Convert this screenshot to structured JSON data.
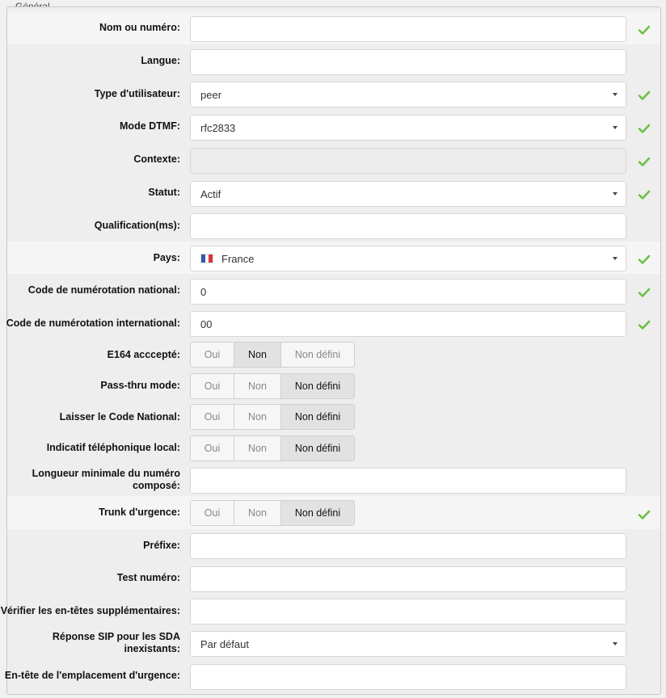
{
  "section_title": "Général",
  "rows": [
    {
      "label": "Nom ou numéro:",
      "type": "input",
      "value": "",
      "check": true
    },
    {
      "label": "Langue:",
      "type": "input",
      "value": "",
      "check": false
    },
    {
      "label": "Type d'utilisateur:",
      "type": "select",
      "value": "peer",
      "check": true
    },
    {
      "label": "Mode DTMF:",
      "type": "select",
      "value": "rfc2833",
      "check": true
    },
    {
      "label": "Contexte:",
      "type": "disabled",
      "value": "",
      "check": true
    },
    {
      "label": "Statut:",
      "type": "select",
      "value": "Actif",
      "check": true
    },
    {
      "label": "Qualification(ms):",
      "type": "input",
      "value": "",
      "check": false
    },
    {
      "label": "Pays:",
      "type": "select-flag",
      "value": "France",
      "check": true
    },
    {
      "label": "Code de numérotation national:",
      "type": "input",
      "value": "0",
      "check": true
    },
    {
      "label": "Code de numérotation international:",
      "type": "input",
      "value": "00",
      "check": true
    },
    {
      "label": "E164 acccepté:",
      "type": "toggle",
      "active": 1,
      "check": false
    },
    {
      "label": "Pass-thru mode:",
      "type": "toggle",
      "active": 2,
      "check": false
    },
    {
      "label": "Laisser le Code National:",
      "type": "toggle",
      "active": 2,
      "check": false
    },
    {
      "label": "Indicatif téléphonique local:",
      "type": "toggle",
      "active": 2,
      "check": false
    },
    {
      "label": "Longueur minimale du numéro composé:",
      "type": "input",
      "value": "",
      "check": false
    },
    {
      "label": "Trunk d'urgence:",
      "type": "toggle",
      "active": 2,
      "check": true
    },
    {
      "label": "Préfixe:",
      "type": "input",
      "value": "",
      "check": false
    },
    {
      "label": "Test numéro:",
      "type": "input",
      "value": "",
      "check": false
    },
    {
      "label": "Vérifier les en-têtes supplémentaires:",
      "type": "input",
      "value": "",
      "check": false
    },
    {
      "label": "Réponse SIP pour les SDA inexistants:",
      "type": "select",
      "value": "Par défaut",
      "check": false
    },
    {
      "label": "En-tête de l'emplacement d'urgence:",
      "type": "input",
      "value": "",
      "check": false
    }
  ],
  "toggle_options": [
    "Oui",
    "Non",
    "Non défini"
  ],
  "colors": {
    "check": "#6cc04a"
  }
}
